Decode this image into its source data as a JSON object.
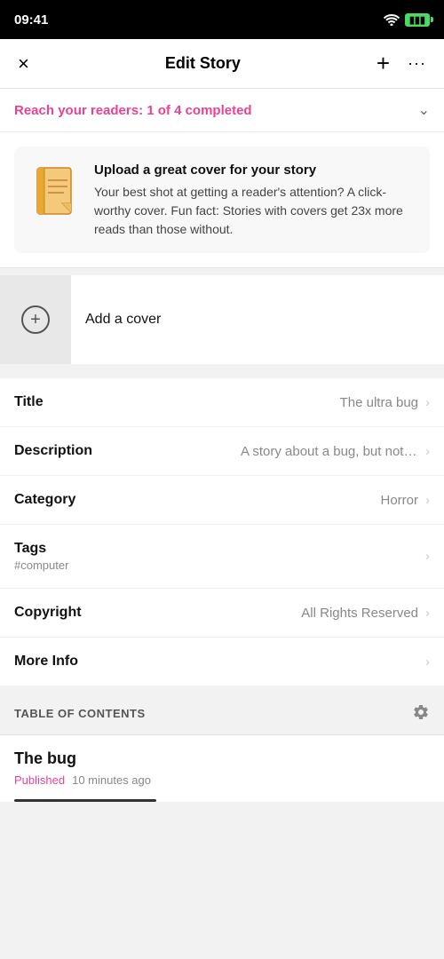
{
  "statusBar": {
    "time": "09:41",
    "wifi": "wifi",
    "battery": "charging"
  },
  "header": {
    "title": "Edit Story",
    "closeLabel": "×",
    "addLabel": "+",
    "moreLabel": "···"
  },
  "banner": {
    "prefix": "Reach your readers: ",
    "highlight": "1 of 4 completed"
  },
  "tipCard": {
    "title": "Upload a great cover for your story",
    "description": "Your best shot at getting a reader's attention? A click-worthy cover. Fun fact: Stories with covers get 23x more reads than those without."
  },
  "coverSection": {
    "addLabel": "Add a cover"
  },
  "listItems": [
    {
      "label": "Title",
      "value": "The ultra bug",
      "sublabel": ""
    },
    {
      "label": "Description",
      "value": "A story about a bug, but not just a...",
      "sublabel": ""
    },
    {
      "label": "Category",
      "value": "Horror",
      "sublabel": ""
    },
    {
      "label": "Tags",
      "value": "",
      "sublabel": "#computer"
    },
    {
      "label": "Copyright",
      "value": "All Rights Reserved",
      "sublabel": ""
    },
    {
      "label": "More Info",
      "value": "",
      "sublabel": ""
    }
  ],
  "toc": {
    "title": "TABLE OF CONTENTS",
    "items": [
      {
        "title": "The bug",
        "status": "Published",
        "time": "10 minutes ago"
      }
    ]
  }
}
